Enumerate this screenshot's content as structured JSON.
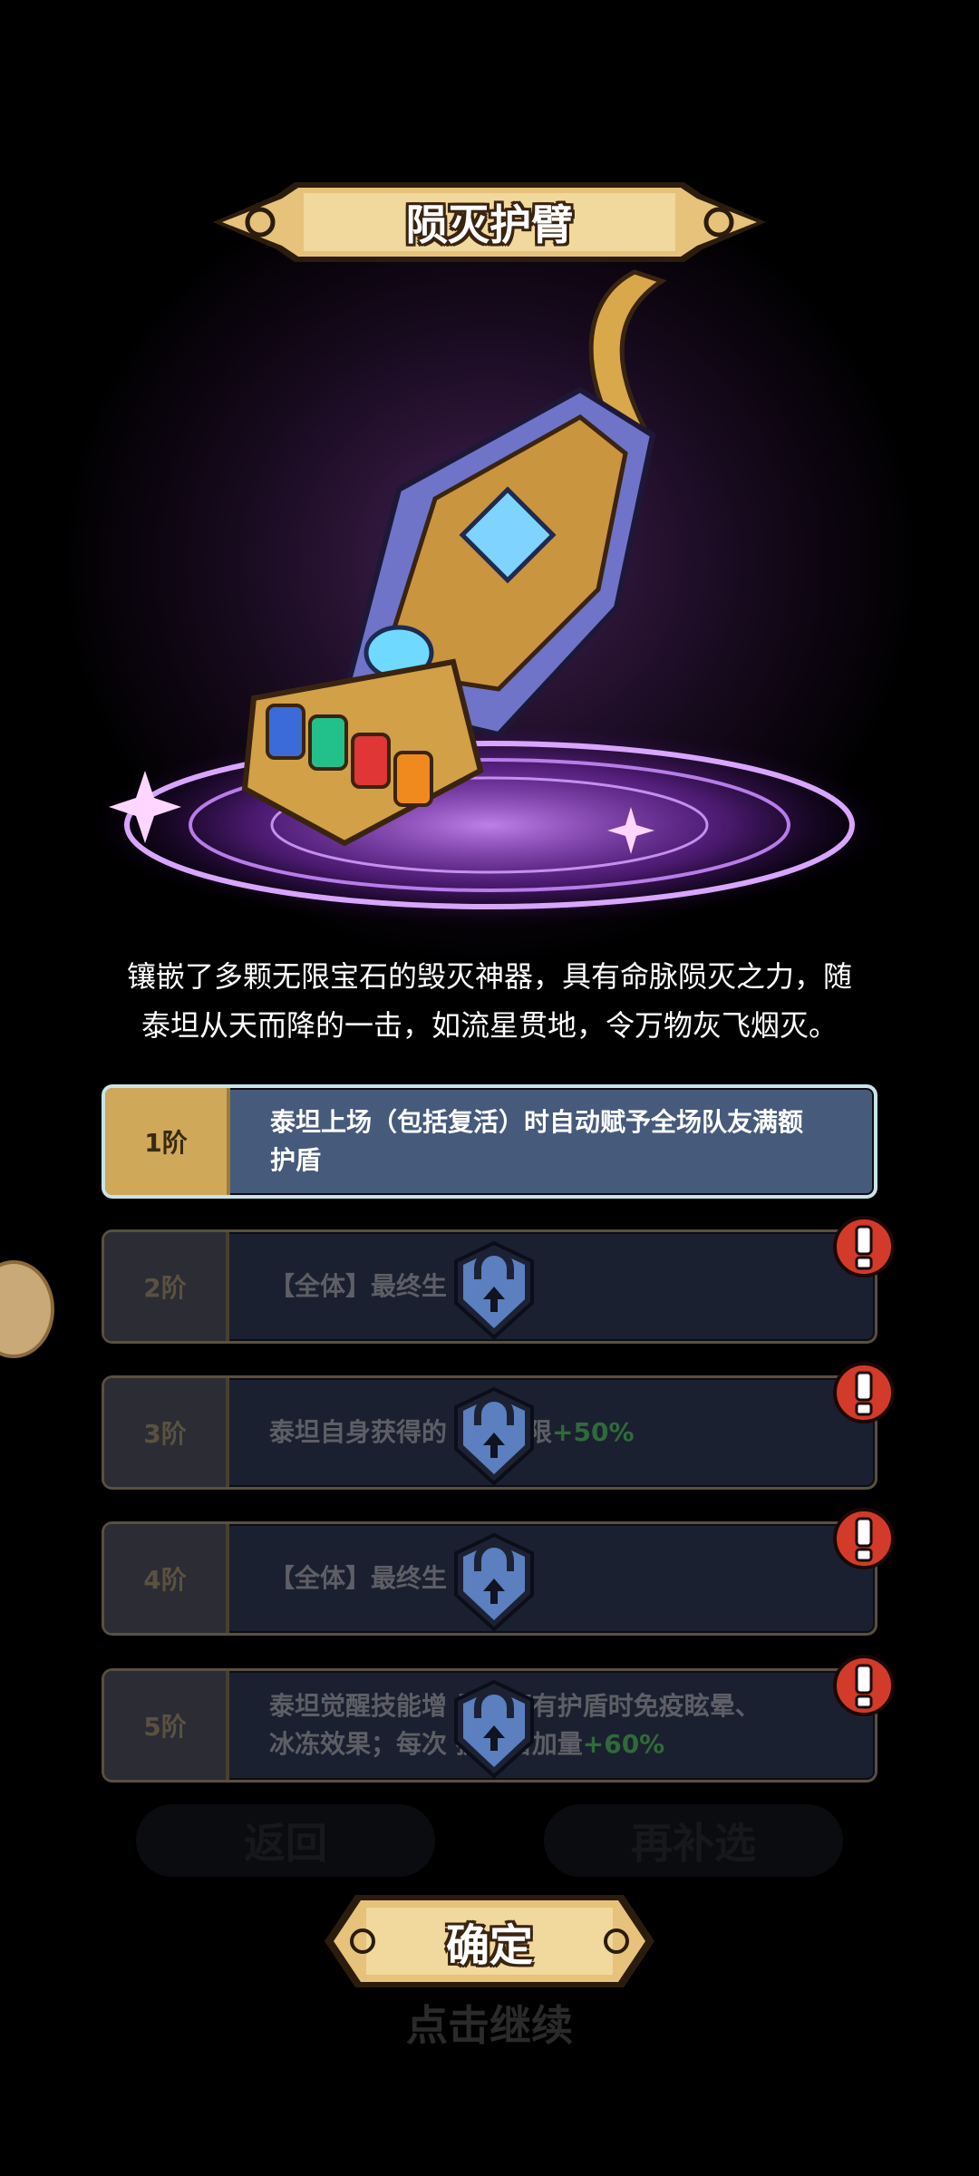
{
  "item": {
    "title": "陨灭护臂",
    "description_line1": "镶嵌了多颗无限宝石的毁灭神器，具有命脉陨灭之力，随",
    "description_line2": "泰坦从天而降的一击，如流星贯地，令万物灰飞烟灭。"
  },
  "tiers": [
    {
      "label": "1阶",
      "text_line1": "泰坦上场（包括复活）时自动赋予全场队友满额",
      "text_line2": "护盾",
      "state": "unlocked"
    },
    {
      "label": "2阶",
      "text_pre": "【全体】最终生",
      "text_bonus": "%",
      "text_post": "",
      "state": "locked"
    },
    {
      "label": "3阶",
      "text_pre": "泰坦自身获得的",
      "text_mid": "上限",
      "text_bonus": "+50%",
      "state": "locked"
    },
    {
      "label": "4阶",
      "text_pre": "【全体】最终生",
      "text_bonus": "%",
      "state": "locked"
    },
    {
      "label": "5阶",
      "text_line1": "泰坦觉醒技能增   果：拥有护盾时免疫眩晕、",
      "text_line2_pre": "冰冻效果；每次   护盾增加量",
      "text_bonus": "+60%",
      "state": "locked"
    }
  ],
  "buttons": {
    "back_label": "返回",
    "skip_label": "再补选",
    "confirm_label": "确定",
    "continue_hint": "点击继续"
  },
  "colors": {
    "gold": "#cfa85a",
    "active_tier_bg": "#465a7c",
    "bonus_green": "#2f6b3a",
    "alert_red": "#d23a2a"
  }
}
